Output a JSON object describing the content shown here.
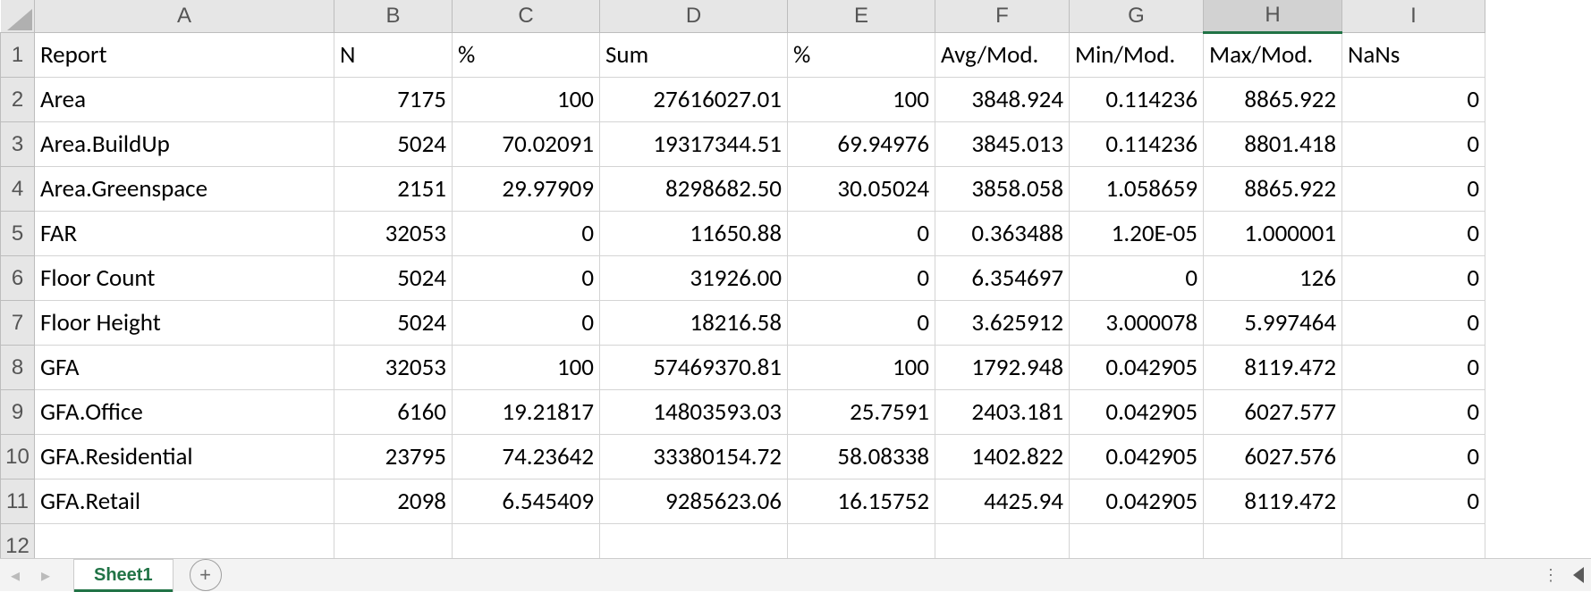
{
  "columns": [
    "A",
    "B",
    "C",
    "D",
    "E",
    "F",
    "G",
    "H",
    "I"
  ],
  "active_column": "H",
  "row_headers": [
    "1",
    "2",
    "3",
    "4",
    "5",
    "6",
    "7",
    "8",
    "9",
    "10",
    "11",
    "12"
  ],
  "headers": {
    "A": "Report",
    "B": "N",
    "C": "%",
    "D": "Sum",
    "E": "%",
    "F": "Avg/Mod.",
    "G": "Min/Mod.",
    "H": "Max/Mod.",
    "I": "NaNs"
  },
  "rows": [
    {
      "A": "Area",
      "B": "7175",
      "C": "100",
      "D": "27616027.01",
      "E": "100",
      "F": "3848.924",
      "G": "0.114236",
      "H": "8865.922",
      "I": "0"
    },
    {
      "A": "Area.BuildUp",
      "B": "5024",
      "C": "70.02091",
      "D": "19317344.51",
      "E": "69.94976",
      "F": "3845.013",
      "G": "0.114236",
      "H": "8801.418",
      "I": "0"
    },
    {
      "A": "Area.Greenspace",
      "B": "2151",
      "C": "29.97909",
      "D": "8298682.50",
      "E": "30.05024",
      "F": "3858.058",
      "G": "1.058659",
      "H": "8865.922",
      "I": "0"
    },
    {
      "A": "FAR",
      "B": "32053",
      "C": "0",
      "D": "11650.88",
      "E": "0",
      "F": "0.363488",
      "G": "1.20E-05",
      "H": "1.000001",
      "I": "0"
    },
    {
      "A": "Floor Count",
      "B": "5024",
      "C": "0",
      "D": "31926.00",
      "E": "0",
      "F": "6.354697",
      "G": "0",
      "H": "126",
      "I": "0"
    },
    {
      "A": "Floor Height",
      "B": "5024",
      "C": "0",
      "D": "18216.58",
      "E": "0",
      "F": "3.625912",
      "G": "3.000078",
      "H": "5.997464",
      "I": "0"
    },
    {
      "A": "GFA",
      "B": "32053",
      "C": "100",
      "D": "57469370.81",
      "E": "100",
      "F": "1792.948",
      "G": "0.042905",
      "H": "8119.472",
      "I": "0"
    },
    {
      "A": "GFA.Office",
      "B": "6160",
      "C": "19.21817",
      "D": "14803593.03",
      "E": "25.7591",
      "F": "2403.181",
      "G": "0.042905",
      "H": "6027.577",
      "I": "0"
    },
    {
      "A": "GFA.Residential",
      "B": "23795",
      "C": "74.23642",
      "D": "33380154.72",
      "E": "58.08338",
      "F": "1402.822",
      "G": "0.042905",
      "H": "6027.576",
      "I": "0"
    },
    {
      "A": "GFA.Retail",
      "B": "2098",
      "C": "6.545409",
      "D": "9285623.06",
      "E": "16.15752",
      "F": "4425.94",
      "G": "0.042905",
      "H": "8119.472",
      "I": "0"
    }
  ],
  "tabbar": {
    "sheet_name": "Sheet1"
  }
}
